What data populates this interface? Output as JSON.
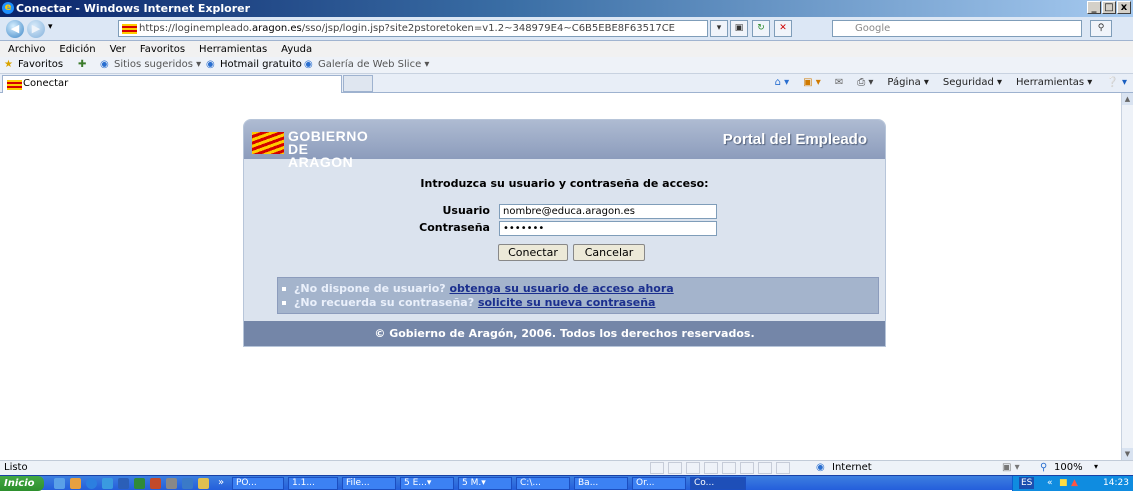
{
  "window": {
    "title": "Conectar - Windows Internet Explorer",
    "controls": [
      "_",
      "□",
      "x"
    ]
  },
  "nav": {
    "url_prefix": "https://loginempleado.",
    "url_domain": "aragon.es",
    "url_rest": "/sso/jsp/login.jsp?site2pstoretoken=v1.2~348979E4~C6B5EBE8F63517CE",
    "search_placeholder": "Google"
  },
  "menu": [
    "Archivo",
    "Edición",
    "Ver",
    "Favoritos",
    "Herramientas",
    "Ayuda"
  ],
  "favorites": {
    "label": "Favoritos",
    "items": [
      "Sitios sugeridos ▾",
      "Hotmail gratuito",
      "Galería de Web Slice ▾"
    ]
  },
  "tab": {
    "label": "Conectar"
  },
  "commands": [
    "Página ▾",
    "Seguridad ▾",
    "Herramientas ▾"
  ],
  "page": {
    "logo_line1": "GOBIERNO",
    "logo_line2": "DE ARAGON",
    "portal_title": "Portal del Empleado",
    "prompt": "Introduzca su usuario y contraseña de acceso:",
    "user_label": "Usuario",
    "user_value": "nombre@educa.aragon.es",
    "password_label": "Contraseña",
    "password_value": "•••••••",
    "connect_button": "Conectar",
    "cancel_button": "Cancelar",
    "link1_text": "¿No dispone de usuario?",
    "link1_link": "obtenga su usuario de acceso ahora",
    "link2_text": "¿No recuerda su contraseña?",
    "link2_link": "solicite su nueva contraseña",
    "footer": "© Gobierno de Aragón, 2006. Todos los derechos reservados."
  },
  "status": {
    "text": "Listo",
    "zone": "Internet",
    "zoom": "100%"
  },
  "taskbar": {
    "start": "Inicio",
    "tasks": [
      "PO...",
      "1.1...",
      "File...",
      "5 E...▾",
      "5 M.▾",
      "C:\\...",
      "Ba...",
      "Or...",
      "Co..."
    ],
    "lang": "ES",
    "clock": "14:23"
  },
  "colors": {
    "panel_header": "#8c9cbc",
    "panel_footer": "#7486a8",
    "link": "#1b2f8e",
    "taskbar": "#245edb"
  }
}
